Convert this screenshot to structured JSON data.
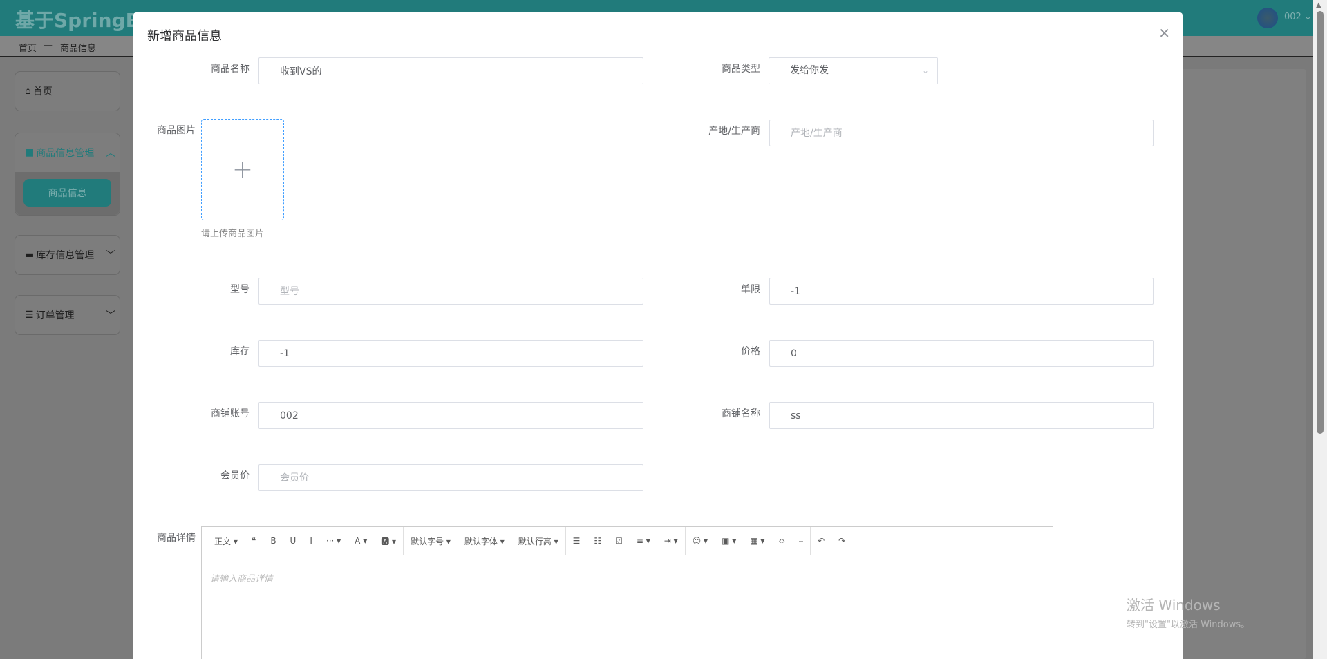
{
  "header": {
    "title": "基于SpringBo",
    "user": "002"
  },
  "breadcrumb": [
    "首页",
    "商品信息"
  ],
  "sidebar": {
    "home": "首页",
    "groups": [
      {
        "label": "商品信息管理",
        "children": [
          "商品信息"
        ]
      },
      {
        "label": "库存信息管理"
      },
      {
        "label": "订单管理"
      }
    ]
  },
  "modal": {
    "title": "新增商品信息",
    "fields": {
      "name": {
        "label": "商品名称",
        "value": "收到VS的"
      },
      "type": {
        "label": "商品类型",
        "value": "发给你发"
      },
      "image": {
        "label": "商品图片",
        "tip": "请上传商品图片"
      },
      "origin": {
        "label": "产地/生产商",
        "placeholder": "产地/生产商"
      },
      "model": {
        "label": "型号",
        "placeholder": "型号"
      },
      "limit": {
        "label": "单限",
        "value": "-1"
      },
      "stock": {
        "label": "库存",
        "value": "-1"
      },
      "price": {
        "label": "价格",
        "value": "0"
      },
      "shop_account": {
        "label": "商铺账号",
        "value": "002"
      },
      "shop_name": {
        "label": "商铺名称",
        "value": "ss"
      },
      "member_price": {
        "label": "会员价",
        "placeholder": "会员价"
      },
      "detail": {
        "label": "商品详情",
        "placeholder": "请输入商品详情"
      }
    },
    "toolbar": [
      "正文 ▾",
      "❝",
      "B",
      "U",
      "I",
      "··· ▾",
      "A ▾",
      "🅰 ▾",
      "默认字号 ▾",
      "默认字体 ▾",
      "默认行高 ▾",
      "☰",
      "☷",
      "☑",
      "≡ ▾",
      "⇥ ▾",
      "☺ ▾",
      "▣ ▾",
      "▦ ▾",
      "‹›",
      "⎯",
      "↶",
      "↷"
    ]
  },
  "watermark": {
    "line1": "激活 Windows",
    "line2": "转到\"设置\"以激活 Windows。"
  }
}
